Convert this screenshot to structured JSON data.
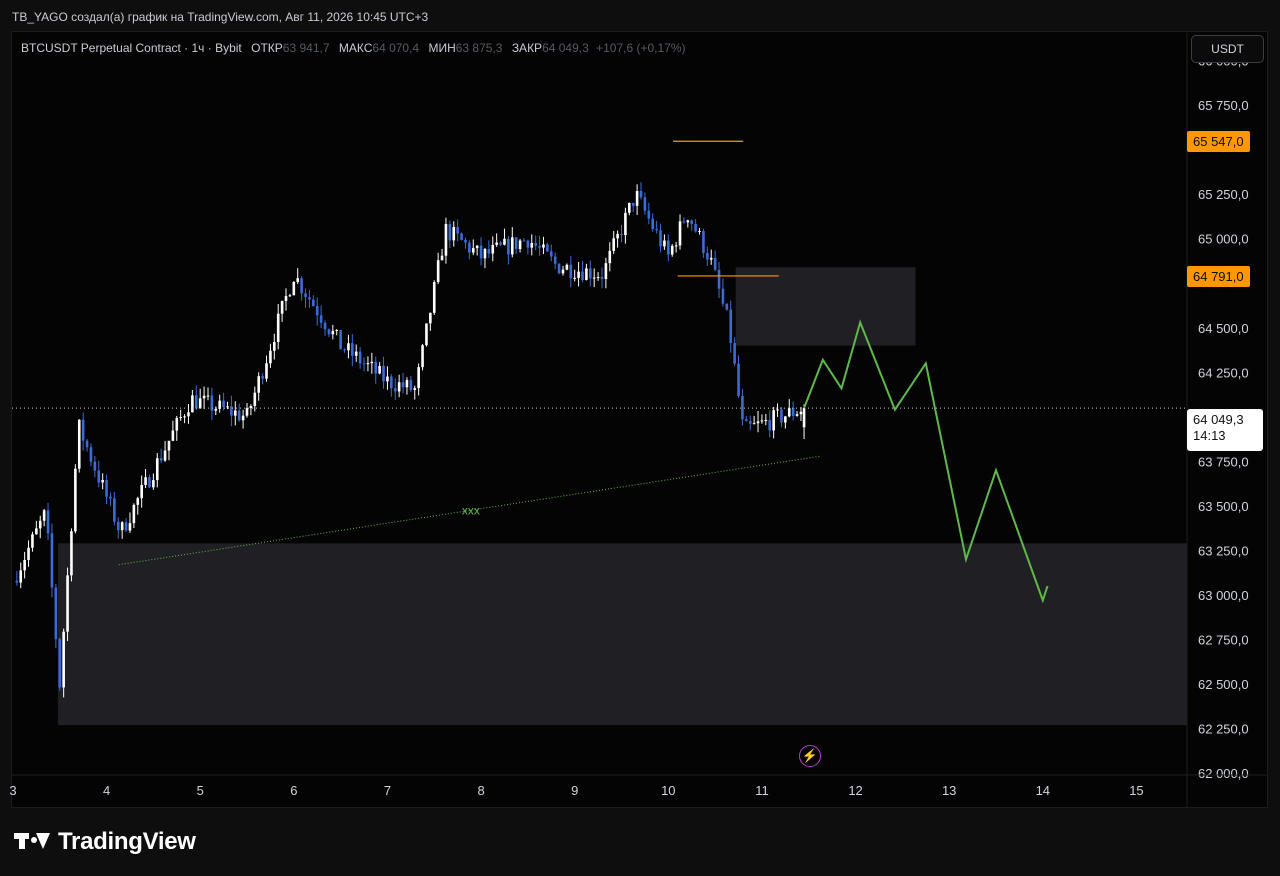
{
  "caption": "TB_YAGO создал(а) график на TradingView.com, Авг 11, 2026 10:45 UTC+3",
  "legend": {
    "symbol": "BTCUSDT Perpetual Contract · 1ч · Bybit",
    "open_label": "ОТКР",
    "open_value": "63 941,7",
    "high_label": "МАКС",
    "high_value": "64 070,4",
    "low_label": "МИН",
    "low_value": "63 875,3",
    "close_label": "ЗАКР",
    "close_value": "64 049,3",
    "change": "+107,6 (+0,17%)"
  },
  "currency": "USDT",
  "tags": {
    "upper_level": "65 547,0",
    "lower_level": "64 791,0",
    "last_price": "64 049,3",
    "countdown": "14:13"
  },
  "trendline_label": "xxx",
  "brand": "TradingView",
  "colors": {
    "background": "#040404",
    "candle_up": "#ffffff",
    "candle_down": "#3b6bd6",
    "level_orange": "#ff9800",
    "projection_green": "#5fb84a",
    "zone_fill": "#2a2a2f"
  },
  "chart_data": {
    "type": "candlestick",
    "symbol": "BTCUSDT Perpetual Contract",
    "interval": "1ч",
    "y_ticks": [
      {
        "value": 66000,
        "label": "66 000,0"
      },
      {
        "value": 65750,
        "label": "65 750,0"
      },
      {
        "value": 65250,
        "label": "65 250,0"
      },
      {
        "value": 65000,
        "label": "65 000,0"
      },
      {
        "value": 64500,
        "label": "64 500,0"
      },
      {
        "value": 64250,
        "label": "64 250,0"
      },
      {
        "value": 63750,
        "label": "63 750,0"
      },
      {
        "value": 63500,
        "label": "63 500,0"
      },
      {
        "value": 63250,
        "label": "63 250,0"
      },
      {
        "value": 63000,
        "label": "63 000,0"
      },
      {
        "value": 62750,
        "label": "62 750,0"
      },
      {
        "value": 62500,
        "label": "62 500,0"
      },
      {
        "value": 62250,
        "label": "62 250,0"
      },
      {
        "value": 62000,
        "label": "62 000,0"
      }
    ],
    "ylim": [
      61990,
      66160
    ],
    "x_ticks": [
      "3",
      "4",
      "5",
      "6",
      "7",
      "8",
      "9",
      "10",
      "11",
      "12",
      "13",
      "14",
      "15"
    ],
    "x_range": [
      2.99,
      15.54
    ],
    "key_points": [
      [
        3.0,
        63080
      ],
      [
        3.35,
        63460
      ],
      [
        3.5,
        62500
      ],
      [
        3.7,
        63950
      ],
      [
        4.15,
        63350
      ],
      [
        4.9,
        64100
      ],
      [
        5.5,
        64000
      ],
      [
        6.0,
        64800
      ],
      [
        6.5,
        64400
      ],
      [
        7.0,
        64200
      ],
      [
        7.3,
        64150
      ],
      [
        7.62,
        65050
      ],
      [
        8.0,
        64900
      ],
      [
        8.5,
        65000
      ],
      [
        8.8,
        64850
      ],
      [
        9.3,
        64800
      ],
      [
        9.65,
        65250
      ],
      [
        10.0,
        64900
      ],
      [
        10.2,
        65150
      ],
      [
        10.45,
        64880
      ],
      [
        10.65,
        64500
      ],
      [
        10.8,
        63920
      ],
      [
        11.2,
        64000
      ],
      [
        11.45,
        64050
      ]
    ],
    "last_candle": {
      "open": 63941.7,
      "high": 64070.4,
      "low": 63875.3,
      "close": 64049.3
    },
    "last_price": 64049.3,
    "levels": [
      {
        "price": 65547,
        "x_start": 10.05,
        "x_end": 10.8
      },
      {
        "price": 64791,
        "x_start": 10.1,
        "x_end": 11.18
      }
    ],
    "zones": [
      {
        "x_start": 3.48,
        "x_end": 15.54,
        "y_low": 62270,
        "y_high": 63290
      },
      {
        "x_start": 10.72,
        "x_end": 12.64,
        "y_low": 64400,
        "y_high": 64840
      }
    ],
    "trendline": {
      "from": [
        4.13,
        63170
      ],
      "to": [
        11.63,
        63780
      ],
      "label": "xxx"
    },
    "projection": [
      [
        11.45,
        64050
      ],
      [
        11.65,
        64320
      ],
      [
        11.85,
        64160
      ],
      [
        12.05,
        64530
      ],
      [
        12.42,
        64040
      ],
      [
        12.75,
        64300
      ],
      [
        13.18,
        63200
      ],
      [
        13.5,
        63700
      ],
      [
        14.0,
        62970
      ],
      [
        14.05,
        63050
      ]
    ],
    "grid": false
  }
}
